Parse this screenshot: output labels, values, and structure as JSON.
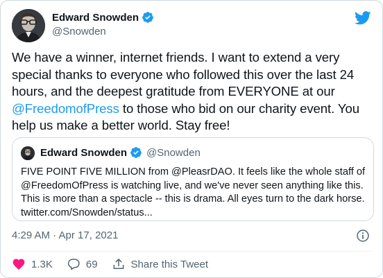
{
  "author": {
    "name": "Edward Snowden",
    "handle": "@Snowden",
    "avatar_icon": "avatar-photo",
    "verified_icon": "verified-badge-icon"
  },
  "brand": {
    "icon": "twitter-bird-icon",
    "color": "#1d9bf0"
  },
  "tweet": {
    "text_before_mention": "We have a winner, internet friends. I want to extend a very special thanks to everyone who followed this over the last 24 hours, and the deepest gratitude from EVERYONE at our ",
    "mention": "@FreedomofPress",
    "text_after_mention": " to those who bid on our charity event. You help us make a better world. Stay free!"
  },
  "quote": {
    "name": "Edward Snowden",
    "handle": "@Snowden",
    "text": "FIVE POINT FIVE MILLION from @PleasrDAO. It feels like the whole staff of @FreedomOfPress is watching live, and we've never seen anything like this. This is more than a spectacle -- this is drama. All eyes turn to the dark horse. twitter.com/Snowden/status..."
  },
  "meta": {
    "timestamp": "4:29 AM · Apr 17, 2021",
    "info_icon": "info-icon"
  },
  "actions": {
    "likes": "1.3K",
    "replies": "69",
    "share_label": "Share this Tweet"
  },
  "colors": {
    "text": "#0f1419",
    "secondary": "#536471",
    "link": "#1d9bf0",
    "border": "#cfd9de",
    "like": "#f91880"
  }
}
